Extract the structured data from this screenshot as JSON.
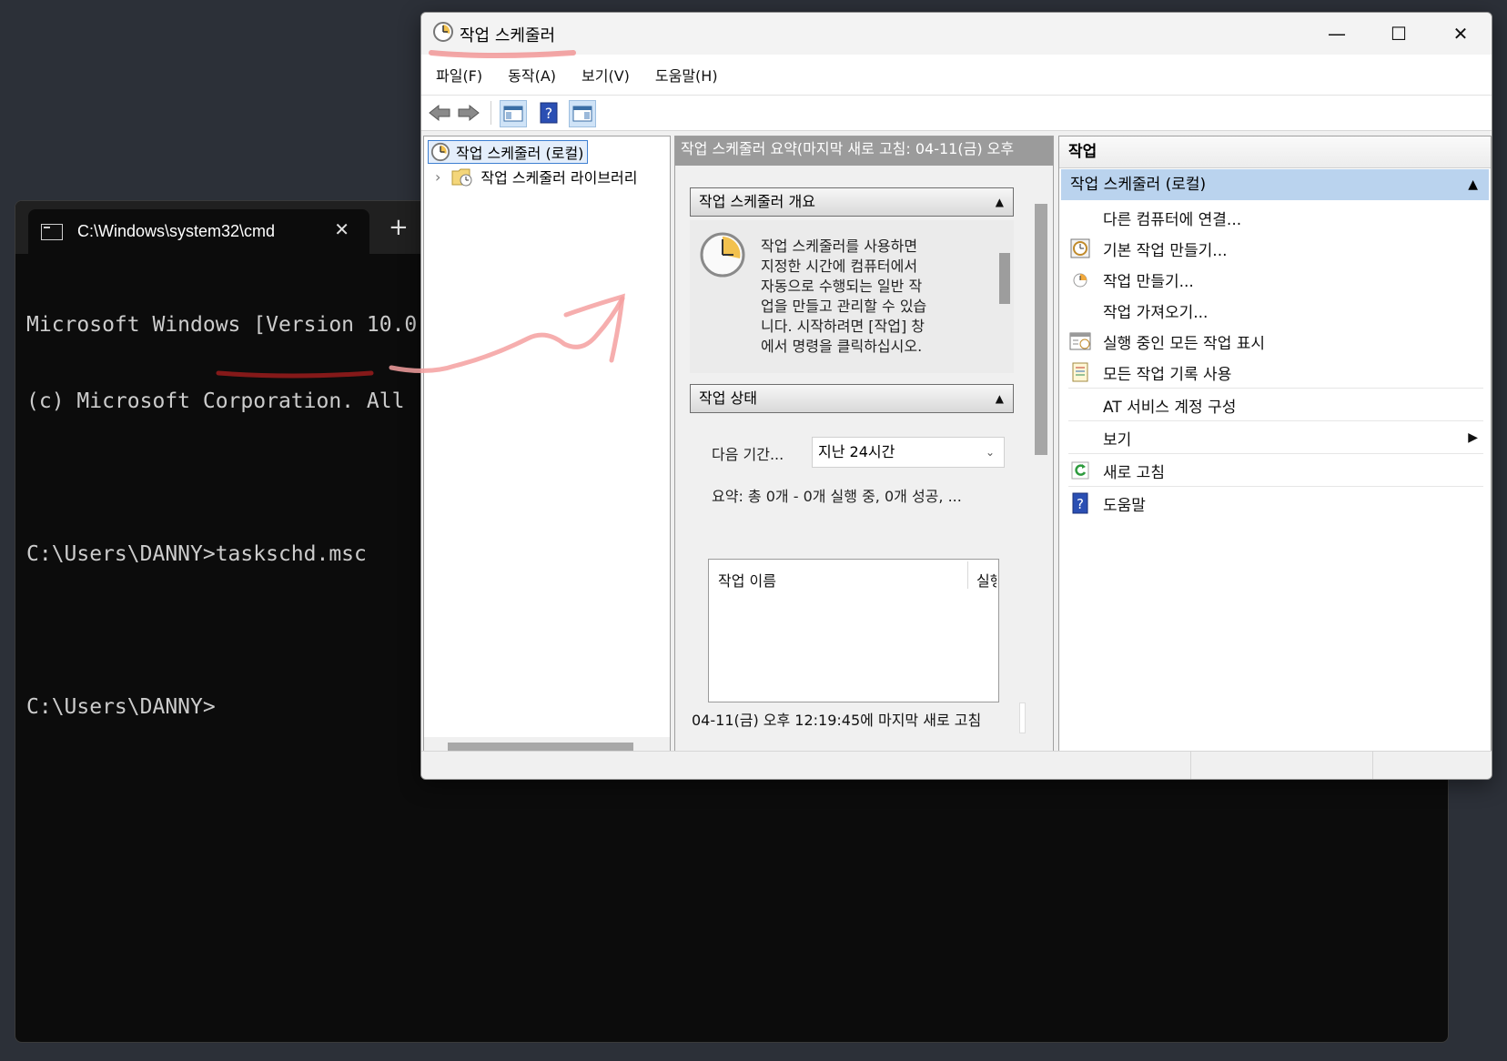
{
  "terminal": {
    "tab_title": "C:\\Windows\\system32\\cmd",
    "new_tab": "+",
    "close": "✕",
    "lines": [
      "Microsoft Windows [Version 10.0",
      "(c) Microsoft Corporation. All",
      "",
      "C:\\Users\\DANNY>taskschd.msc",
      "",
      "C:\\Users\\DANNY>"
    ]
  },
  "scheduler": {
    "title": "작업 스케줄러",
    "window_buttons": {
      "minimize": "—",
      "maximize": "☐",
      "close": "✕"
    },
    "menu": [
      "파일(F)",
      "동작(A)",
      "보기(V)",
      "도움말(H)"
    ],
    "tree": {
      "root": "작업 스케줄러 (로컬)",
      "expander": "›",
      "child": "작업 스케줄러 라이브러리"
    },
    "middle": {
      "header": "작업 스케줄러 요약(마지막 새로 고침: 04-11(금) 오후",
      "overview_title": "작업 스케줄러 개요",
      "overview_text": "작업 스케줄러를 사용하면\n지정한 시간에 컴퓨터에서\n자동으로 수행되는 일반 작\n업을 만들고 관리할 수 있습\n니다. 시작하려면 [작업] 창\n에서 명령을 클릭하십시오.",
      "status_title": "작업 상태",
      "period_label": "다음 기간...",
      "period_value": "지난 24시간",
      "summary": "요약: 총 0개 - 0개 실행 중, 0개 성공, ...",
      "col_name": "작업 이름",
      "col_run": "실행",
      "footer": "04-11(금) 오후 12:19:45에 마지막 새로 고침"
    },
    "actions": {
      "title": "작업",
      "group": "작업 스케줄러 (로컬)",
      "items": [
        {
          "label": "다른 컴퓨터에 연결...",
          "icon": "none"
        },
        {
          "label": "기본 작업 만들기...",
          "icon": "basic-task-icon"
        },
        {
          "label": "작업 만들기...",
          "icon": "create-task-icon"
        },
        {
          "label": "작업 가져오기...",
          "icon": "none"
        },
        {
          "label": "실행 중인 모든 작업 표시",
          "icon": "running-tasks-icon"
        },
        {
          "label": "모든 작업 기록 사용",
          "icon": "history-icon"
        },
        {
          "label": "AT 서비스 계정 구성",
          "icon": "none"
        },
        {
          "label": "보기",
          "icon": "none"
        },
        {
          "label": "새로 고침",
          "icon": "refresh-icon"
        },
        {
          "label": "도움말",
          "icon": "help-icon"
        }
      ]
    }
  },
  "colors": {
    "selection": "#bad3ee",
    "annotation": "#f08a8a"
  }
}
